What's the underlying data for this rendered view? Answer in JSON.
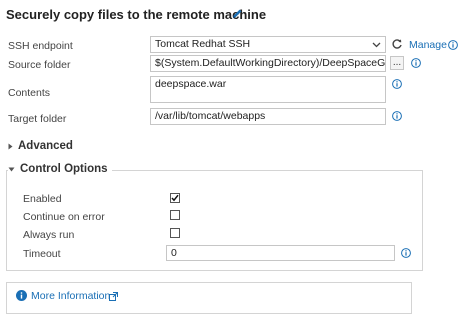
{
  "task": {
    "title": "Securely copy files to the remote machine"
  },
  "fields": {
    "ssh_endpoint": {
      "label": "SSH endpoint",
      "value": "Tomcat Redhat SSH",
      "manage_label": "Manage"
    },
    "source_folder": {
      "label": "Source folder",
      "value": "$(System.DefaultWorkingDirectory)/DeepSpaceGithubM",
      "browse_label": "..."
    },
    "contents": {
      "label": "Contents",
      "value": "deepspace.war"
    },
    "target_folder": {
      "label": "Target folder",
      "value": "/var/lib/tomcat/webapps"
    }
  },
  "sections": {
    "advanced": {
      "label": "Advanced",
      "expanded": false
    },
    "control_options": {
      "label": "Control Options",
      "expanded": true
    }
  },
  "control_options": {
    "enabled": {
      "label": "Enabled",
      "checked": true
    },
    "continue_on_error": {
      "label": "Continue on error",
      "checked": false
    },
    "always_run": {
      "label": "Always run",
      "checked": false
    },
    "timeout": {
      "label": "Timeout",
      "value": "0"
    }
  },
  "more_info": {
    "label": "More Information"
  },
  "colors": {
    "accent": "#1a6fb5",
    "border": "#c6c6c6"
  },
  "icons": [
    "pencil-icon",
    "chevron-down-icon",
    "refresh-icon",
    "info-icon",
    "external-link-icon",
    "caret-right-icon",
    "caret-down-icon",
    "checkmark-icon"
  ]
}
